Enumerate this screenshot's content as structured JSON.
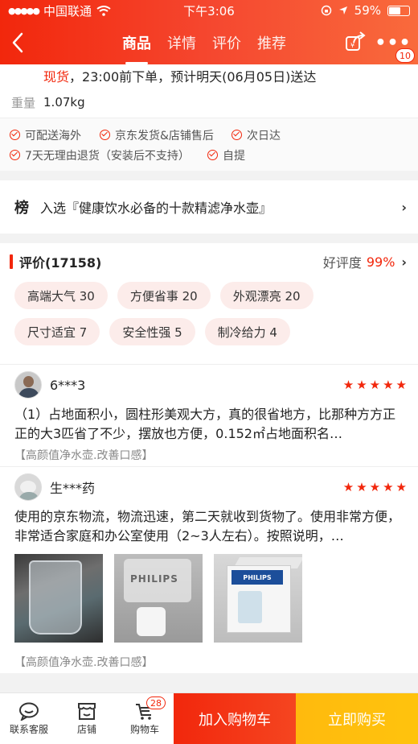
{
  "status_bar": {
    "carrier": "中国联通",
    "time": "下午3:06",
    "battery": "59%"
  },
  "nav": {
    "tabs": [
      "商品",
      "详情",
      "评价",
      "推荐"
    ],
    "active_tab": "商品",
    "more_badge": "10"
  },
  "delivery": {
    "stock": "现货",
    "text": "，23:00前下单，预计明天(06月05日)送达"
  },
  "weight": {
    "label": "重量",
    "value": "1.07kg"
  },
  "services": {
    "row1": [
      "可配送海外",
      "京东发货&店铺售后",
      "次日达"
    ],
    "row2": [
      "7天无理由退货（安装后不支持）",
      "自提"
    ]
  },
  "rank": {
    "badge": "榜",
    "text": "入选『健康饮水必备的十款精滤净水壶』"
  },
  "reviews": {
    "title": "评价(17158)",
    "rate_label": "好评度",
    "rate_value": "99%",
    "tags_row1": [
      "高端大气 30",
      "方便省事 20",
      "外观漂亮 20"
    ],
    "tags_row2": [
      "尺寸适宜 7",
      "安全性强 5",
      "制冷给力 4"
    ],
    "items": [
      {
        "user": "6***3",
        "stars": 5,
        "text": "（1）占地面积小，圆柱形美观大方，真的很省地方，比那种方方正正的大3匹省了不少，摆放也方便，0.152㎡占地面积名…",
        "tag": "【高颜值净水壶.改善口感】"
      },
      {
        "user": "生***药",
        "stars": 5,
        "text": "使用的京东物流，物流迅速，第二天就收到货物了。使用非常方便，非常适合家庭和办公室使用（2~3人左右）。按照说明，…",
        "tag": "【高颜值净水壶.改善口感】",
        "photo_brand": "PHILIPS"
      }
    ]
  },
  "bottom_bar": {
    "service": "联系客服",
    "shop": "店铺",
    "cart": "购物车",
    "cart_count": "28",
    "add_to_cart": "加入购物车",
    "buy_now": "立即购买"
  },
  "colors": {
    "brand_red": "#f2270c",
    "buy_yellow": "#ffba0d"
  }
}
